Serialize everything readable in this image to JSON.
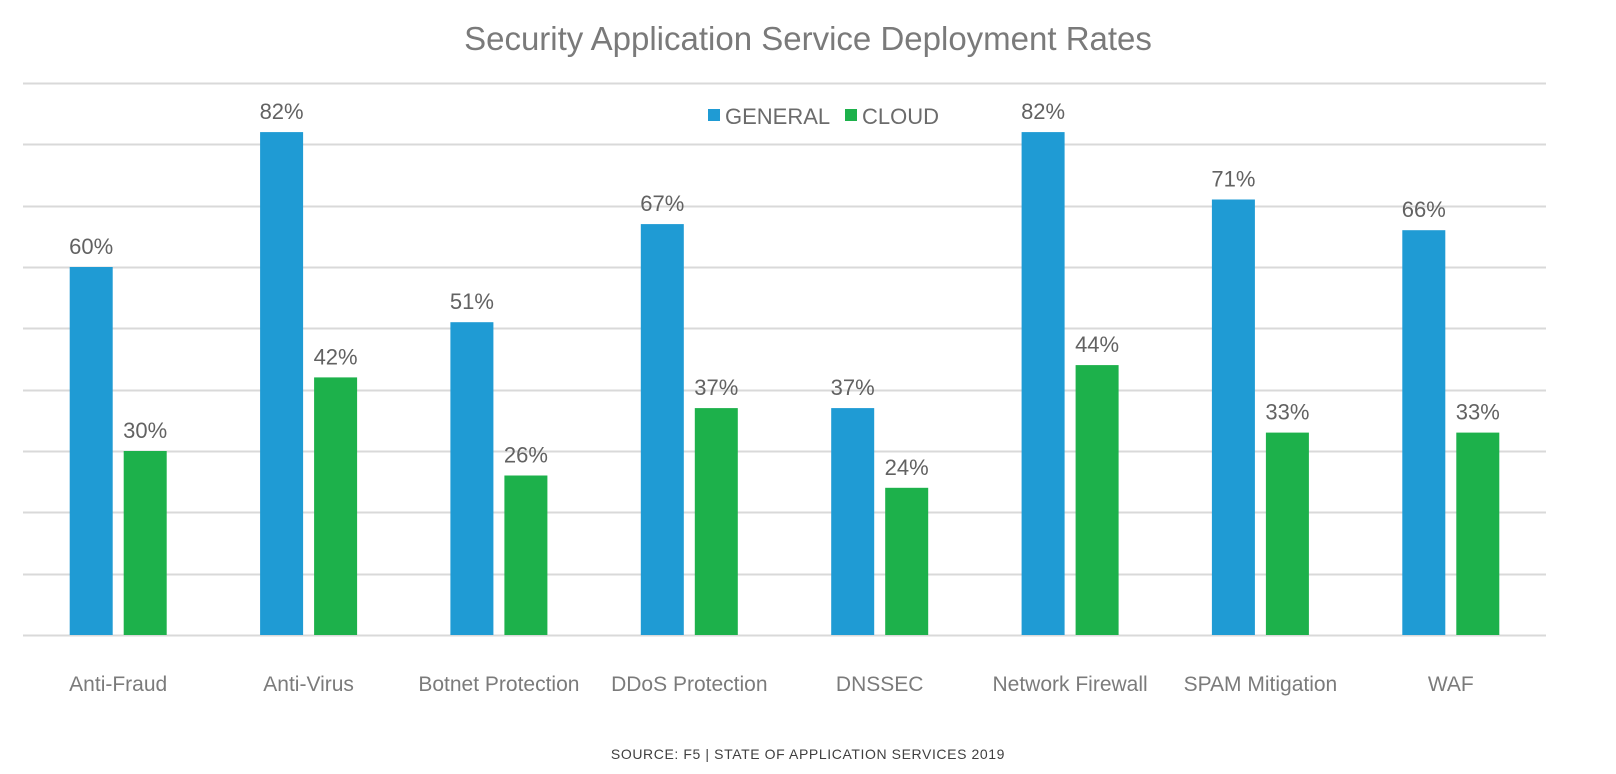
{
  "chart_data": {
    "type": "bar",
    "title": "Security Application Service Deployment Rates",
    "xlabel": "",
    "ylabel": "",
    "ylim": [
      0,
      90
    ],
    "grid": true,
    "grid_step": 10,
    "legend_position": "top-center",
    "categories": [
      "Anti-Fraud",
      "Anti-Virus",
      "Botnet Protection",
      "DDoS Protection",
      "DNSSEC",
      "Network Firewall",
      "SPAM Mitigation",
      "WAF"
    ],
    "series": [
      {
        "name": "GENERAL",
        "color": "#1f9bd4",
        "values": [
          60,
          82,
          51,
          67,
          37,
          82,
          71,
          66
        ]
      },
      {
        "name": "CLOUD",
        "color": "#1db14b",
        "values": [
          30,
          42,
          26,
          37,
          24,
          44,
          33,
          33
        ]
      }
    ],
    "value_format": "{v}%",
    "source": "SOURCE: F5 | STATE OF APPLICATION SERVICES 2019"
  }
}
